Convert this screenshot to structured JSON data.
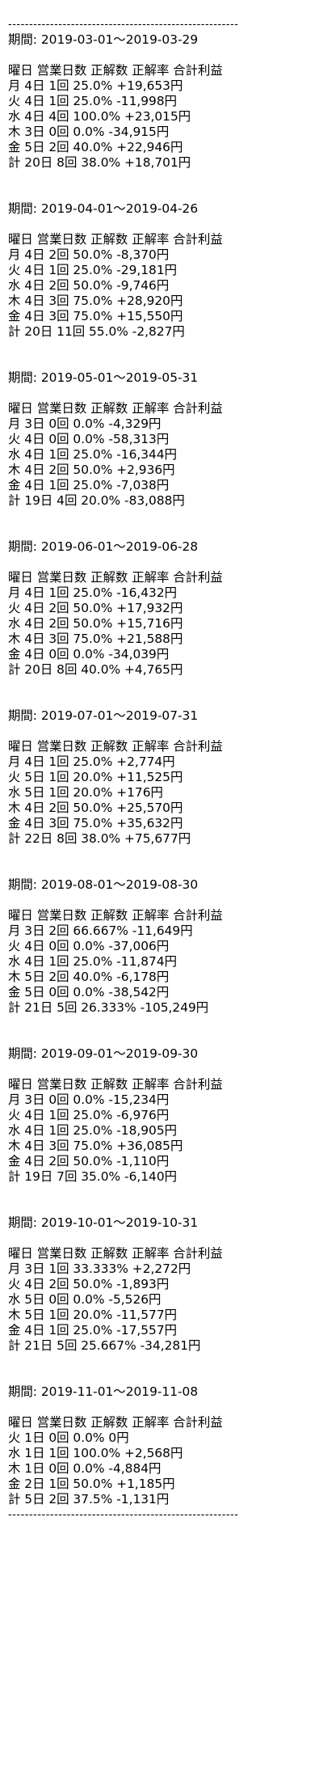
{
  "divider": "-------------------------------------------------------",
  "header": "曜日 営業日数 正解数 正解率 合計利益",
  "blocks": [
    {
      "period": "期間: 2019-03-01～2019-03-29",
      "rows": [
        "月 4日 1回 25.0% +19,653円",
        "火 4日 1回 25.0% -11,998円",
        "水 4日 4回 100.0% +23,015円",
        "木 3日 0回 0.0% -34,915円",
        "金 5日 2回 40.0% +22,946円",
        "計 20日 8回 38.0% +18,701円"
      ]
    },
    {
      "period": "期間: 2019-04-01～2019-04-26",
      "rows": [
        "月 4日 2回 50.0% -8,370円",
        "火 4日 1回 25.0% -29,181円",
        "水 4日 2回 50.0% -9,746円",
        "木 4日 3回 75.0% +28,920円",
        "金 4日 3回 75.0% +15,550円",
        "計 20日 11回 55.0% -2,827円"
      ]
    },
    {
      "period": "期間: 2019-05-01～2019-05-31",
      "rows": [
        "月 3日 0回 0.0% -4,329円",
        "火 4日 0回 0.0% -58,313円",
        "水 4日 1回 25.0% -16,344円",
        "木 4日 2回 50.0% +2,936円",
        "金 4日 1回 25.0% -7,038円",
        "計 19日 4回 20.0% -83,088円"
      ]
    },
    {
      "period": "期間: 2019-06-01～2019-06-28",
      "rows": [
        "月 4日 1回 25.0% -16,432円",
        "火 4日 2回 50.0% +17,932円",
        "水 4日 2回 50.0% +15,716円",
        "木 4日 3回 75.0% +21,588円",
        "金 4日 0回 0.0% -34,039円",
        "計 20日 8回 40.0% +4,765円"
      ]
    },
    {
      "period": "期間: 2019-07-01～2019-07-31",
      "rows": [
        "月 4日 1回 25.0% +2,774円",
        "火 5日 1回 20.0% +11,525円",
        "水 5日 1回 20.0% +176円",
        "木 4日 2回 50.0% +25,570円",
        "金 4日 3回 75.0% +35,632円",
        "計 22日 8回 38.0% +75,677円"
      ]
    },
    {
      "period": "期間: 2019-08-01～2019-08-30",
      "rows": [
        "月 3日 2回 66.667% -11,649円",
        "火 4日 0回 0.0% -37,006円",
        "水 4日 1回 25.0% -11,874円",
        "木 5日 2回 40.0% -6,178円",
        "金 5日 0回 0.0% -38,542円",
        "計 21日 5回 26.333% -105,249円"
      ]
    },
    {
      "period": "期間: 2019-09-01～2019-09-30",
      "rows": [
        "月 3日 0回 0.0% -15,234円",
        "火 4日 1回 25.0% -6,976円",
        "水 4日 1回 25.0% -18,905円",
        "木 4日 3回 75.0% +36,085円",
        "金 4日 2回 50.0% -1,110円",
        "計 19日 7回 35.0% -6,140円"
      ]
    },
    {
      "period": "期間: 2019-10-01～2019-10-31",
      "rows": [
        "月 3日 1回 33.333% +2,272円",
        "火 4日 2回 50.0% -1,893円",
        "水 5日 0回 0.0% -5,526円",
        "木 5日 1回 20.0% -11,577円",
        "金 4日 1回 25.0% -17,557円",
        "計 21日 5回 25.667% -34,281円"
      ]
    },
    {
      "period": "期間: 2019-11-01～2019-11-08",
      "rows": [
        "火 1日 0回 0.0% 0円",
        "水 1日 1回 100.0% +2,568円",
        "木 1日 0回 0.0% -4,884円",
        "金 2日 1回 50.0% +1,185円",
        "計 5日 2回 37.5% -1,131円"
      ]
    }
  ]
}
